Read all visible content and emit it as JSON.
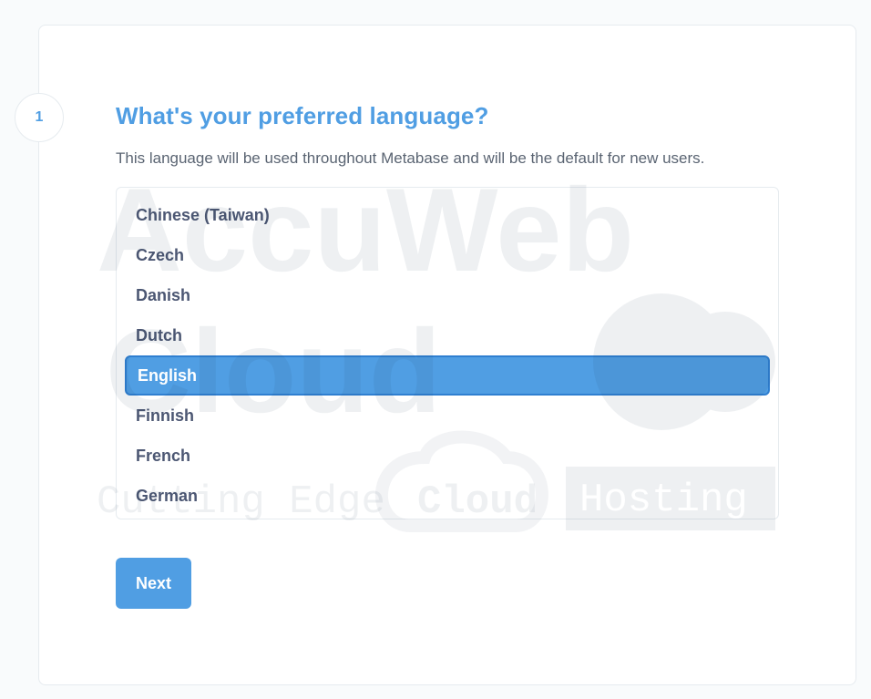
{
  "step": {
    "number": "1"
  },
  "header": {
    "title": "What's your preferred language?",
    "subtitle": "This language will be used throughout Metabase and will be the default for new users."
  },
  "languages": {
    "items": [
      {
        "label": "Chinese (Taiwan)",
        "selected": false
      },
      {
        "label": "Czech",
        "selected": false
      },
      {
        "label": "Danish",
        "selected": false
      },
      {
        "label": "Dutch",
        "selected": false
      },
      {
        "label": "English",
        "selected": true
      },
      {
        "label": "Finnish",
        "selected": false
      },
      {
        "label": "French",
        "selected": false
      },
      {
        "label": "German",
        "selected": false
      }
    ]
  },
  "actions": {
    "next_label": "Next"
  },
  "watermark": {
    "line1": "AccuWeb",
    "line2": "Cloud",
    "line3_left": "Cutting Edge",
    "line3_pill": "Cloud",
    "line3_right": "Hosting"
  },
  "colors": {
    "accent": "#509ee3",
    "text": "#4c5773",
    "muted": "#5a6472",
    "border": "#e6ebef",
    "background": "#f9fbfc"
  }
}
